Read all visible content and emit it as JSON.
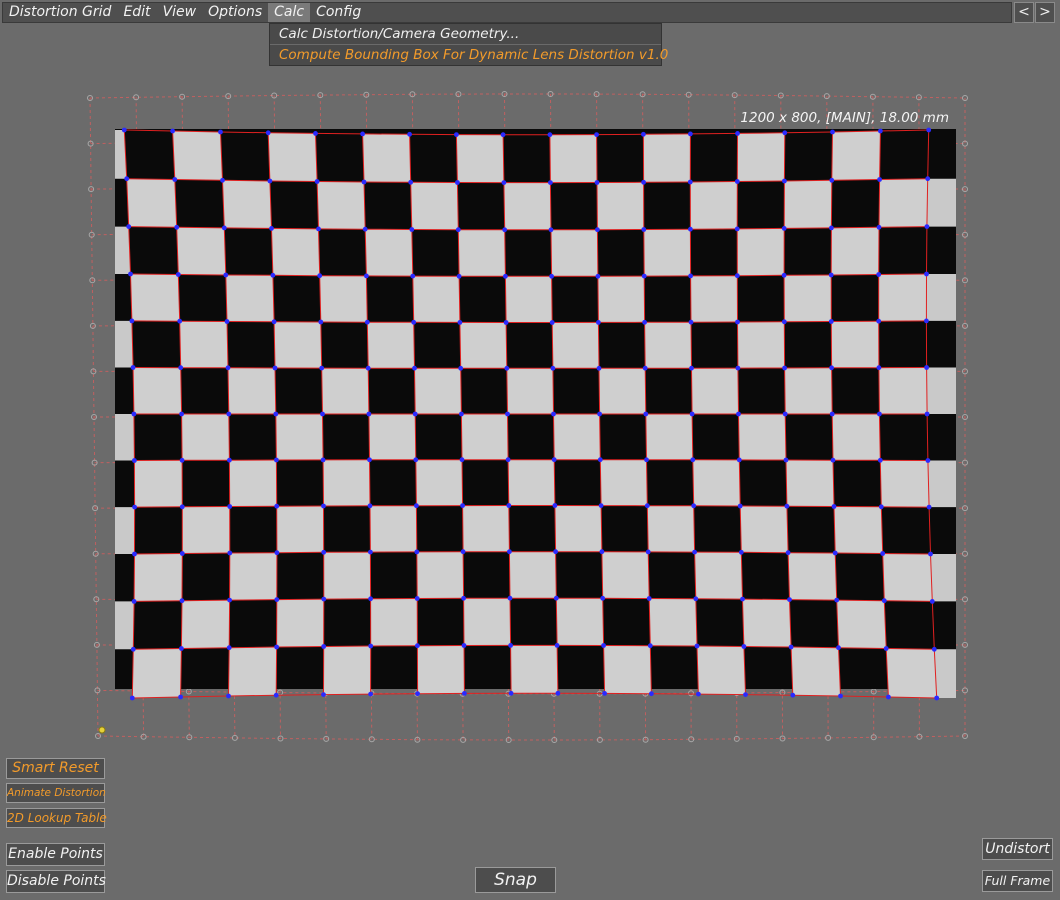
{
  "menubar": {
    "items": [
      "Distortion Grid",
      "Edit",
      "View",
      "Options",
      "Calc",
      "Config"
    ],
    "active_index": 4,
    "prev_label": "<",
    "next_label": ">"
  },
  "calc_menu": {
    "items": [
      "Calc Distortion/Camera Geometry...",
      "Compute Bounding Box For Dynamic Lens Distortion v1.0"
    ]
  },
  "viewport": {
    "info": "1200 x 800, [MAIN], 18.00 mm"
  },
  "buttons": {
    "smart_reset": "Smart Reset",
    "animate_distortion": "Animate Distortion",
    "lookup_table": "2D Lookup Table",
    "enable_points": "Enable Points",
    "disable_points": "Disable Points",
    "snap": "Snap",
    "undistort": "Undistort",
    "full_frame": "Full Frame"
  },
  "colors": {
    "background": "#6b6b6b",
    "accent_orange": "#f29b2b",
    "grid_line": "#e02020",
    "point": "#2a2aff",
    "outer_grid": "#c06060"
  }
}
